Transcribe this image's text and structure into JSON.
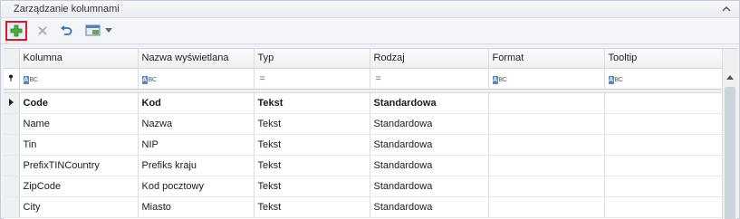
{
  "panel": {
    "title": "Zarządzanie kolumnami"
  },
  "toolbar": {
    "add": "add-icon",
    "delete": "delete-icon",
    "undo": "undo-icon",
    "view": "grid-view-icon"
  },
  "columns": [
    "Kolumna",
    "Nazwa wyświetlana",
    "Typ",
    "Rodzaj",
    "Format",
    "Tooltip"
  ],
  "filter_icons": [
    "abc-icon",
    "abc-icon",
    "equals-icon",
    "equals-icon",
    "abc-icon",
    "abc-icon"
  ],
  "rows": [
    {
      "kolumna": "Code",
      "nazwa": "Kod",
      "typ": "Tekst",
      "rodzaj": "Standardowa",
      "format": "",
      "tooltip": ""
    },
    {
      "kolumna": "Name",
      "nazwa": "Nazwa",
      "typ": "Tekst",
      "rodzaj": "Standardowa",
      "format": "",
      "tooltip": ""
    },
    {
      "kolumna": "Tin",
      "nazwa": "NIP",
      "typ": "Tekst",
      "rodzaj": "Standardowa",
      "format": "",
      "tooltip": ""
    },
    {
      "kolumna": "PrefixTINCountry",
      "nazwa": "Prefiks kraju",
      "typ": "Tekst",
      "rodzaj": "Standardowa",
      "format": "",
      "tooltip": ""
    },
    {
      "kolumna": "ZipCode",
      "nazwa": "Kod pocztowy",
      "typ": "Tekst",
      "rodzaj": "Standardowa",
      "format": "",
      "tooltip": ""
    },
    {
      "kolumna": "City",
      "nazwa": "Miasto",
      "typ": "Tekst",
      "rodzaj": "Standardowa",
      "format": "",
      "tooltip": ""
    }
  ],
  "colors": {
    "add_highlight": "#e01a22",
    "accent": "#4a6fa0"
  }
}
